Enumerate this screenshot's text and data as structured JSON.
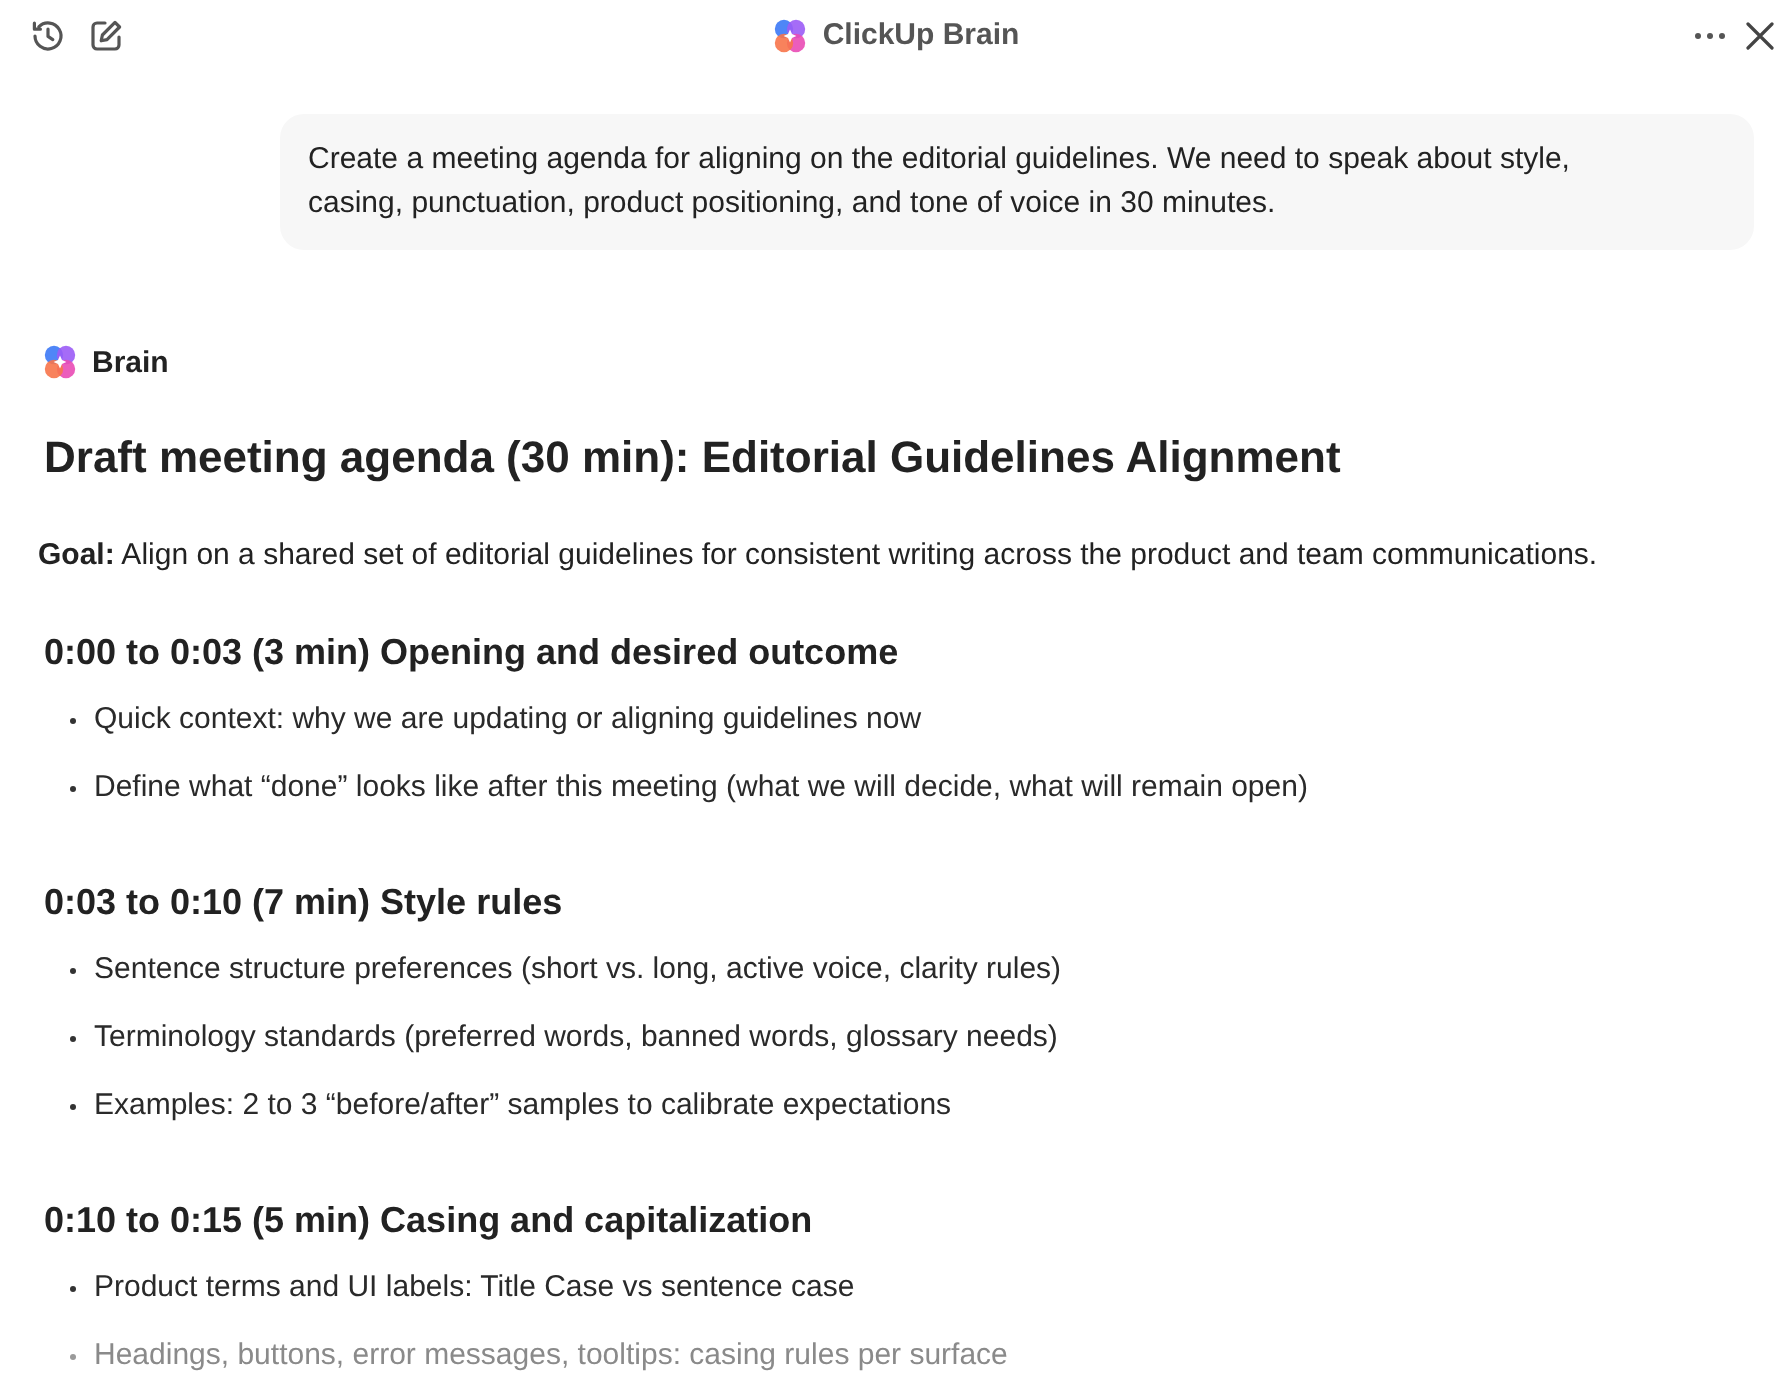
{
  "header": {
    "title": "ClickUp Brain"
  },
  "user_message": {
    "text": "Create a meeting agenda for aligning on the editorial guidelines. We need to speak about style, casing, punctuation, product positioning, and tone of voice in 30 minutes."
  },
  "response": {
    "author": "Brain",
    "title": "Draft meeting agenda (30 min): Editorial Guidelines Alignment",
    "goal": "**Goal:** Align on a shared set of editorial guidelines for consistent writing across the product and team communications.",
    "sections": [
      {
        "heading": "0:00 to 0:03 (3 min) Opening and desired outcome",
        "bullets": [
          {
            "text": "Quick context: why we are updating or aligning guidelines now",
            "faded": false
          },
          {
            "text": "Define what “done” looks like after this meeting (what we will decide, what will remain open)",
            "faded": false
          }
        ]
      },
      {
        "heading": "0:03 to 0:10 (7 min) Style rules",
        "bullets": [
          {
            "text": "Sentence structure preferences (short vs. long, active voice, clarity rules)",
            "faded": false
          },
          {
            "text": "Terminology standards (preferred words, banned words, glossary needs)",
            "faded": false
          },
          {
            "text": "Examples: 2 to 3 “before/after” samples to calibrate expectations",
            "faded": false
          }
        ]
      },
      {
        "heading": "0:10 to 0:15 (5 min) Casing and capitalization",
        "bullets": [
          {
            "text": "Product terms and UI labels: Title Case vs sentence case",
            "faded": false
          },
          {
            "text": "Headings, buttons, error messages, tooltips: casing rules per surface",
            "faded": true
          }
        ]
      }
    ]
  }
}
